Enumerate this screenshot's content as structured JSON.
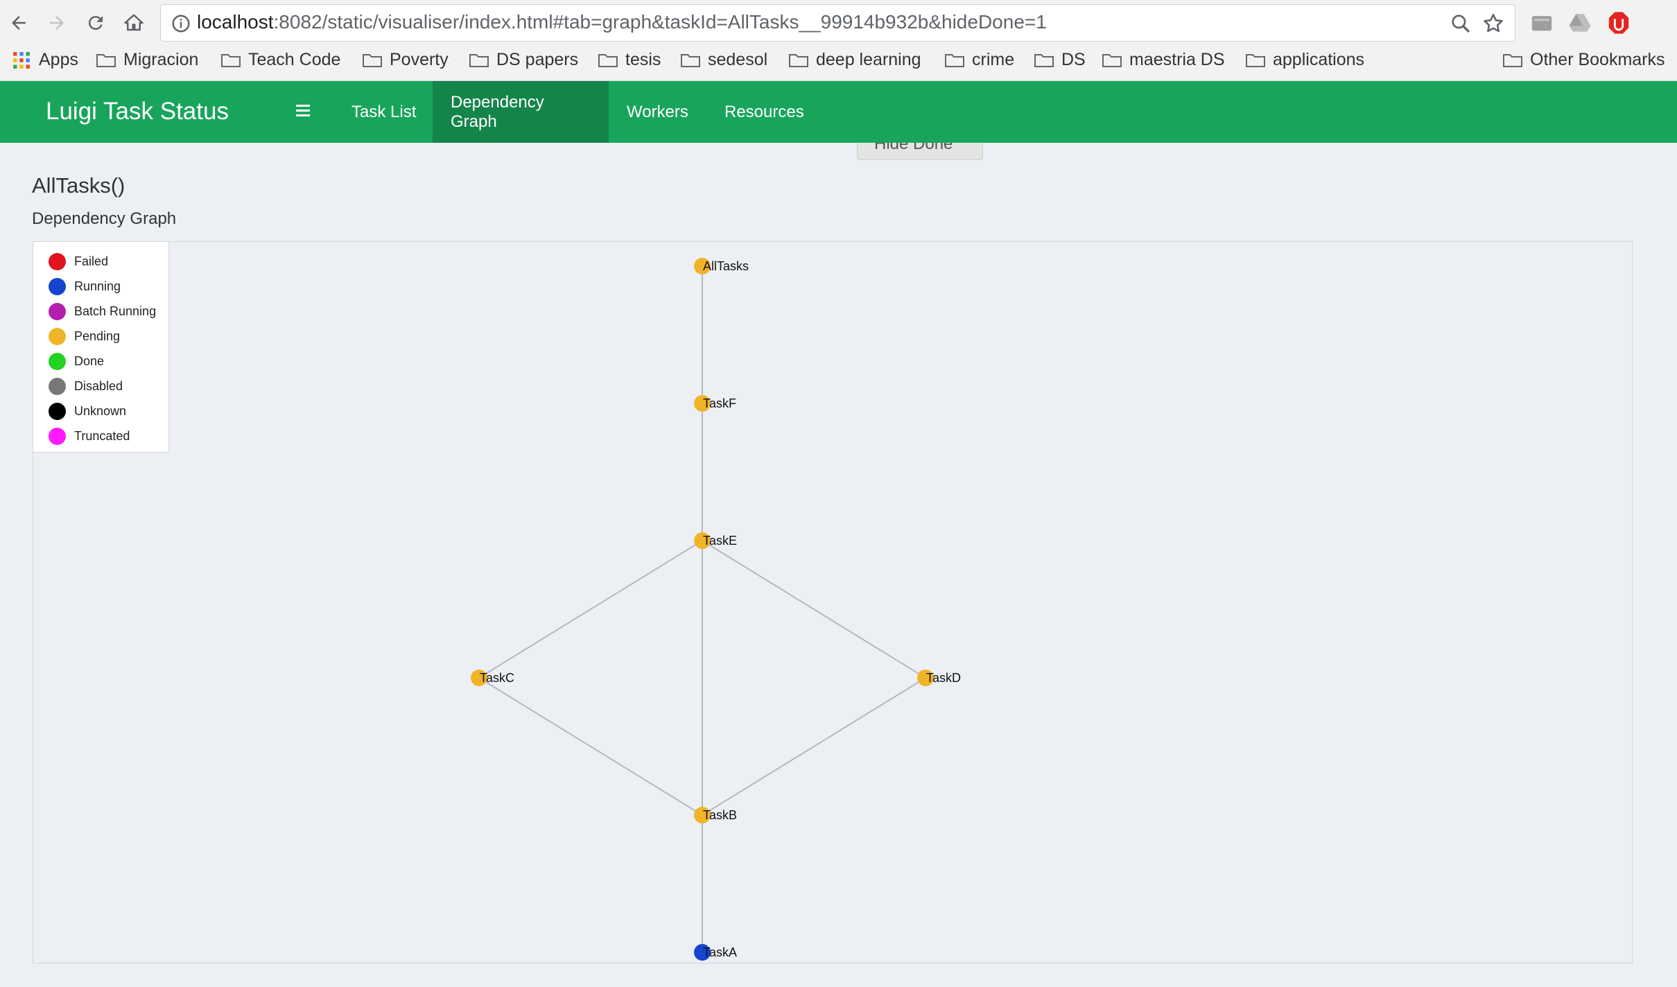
{
  "browser": {
    "url_host": "localhost",
    "url_rest": ":8082/static/visualiser/index.html#tab=graph&taskId=AllTasks__99914b932b&hideDone=1",
    "bookmarks": [
      {
        "label": "Apps",
        "icon": "apps-grid-icon"
      },
      {
        "label": "Migracion",
        "icon": "folder-icon"
      },
      {
        "label": "Teach Code",
        "icon": "folder-icon"
      },
      {
        "label": "Poverty",
        "icon": "folder-icon"
      },
      {
        "label": "DS papers",
        "icon": "folder-icon"
      },
      {
        "label": "tesis",
        "icon": "folder-icon"
      },
      {
        "label": "sedesol",
        "icon": "folder-icon"
      },
      {
        "label": "deep learning",
        "icon": "folder-icon"
      },
      {
        "label": "crime",
        "icon": "folder-icon"
      },
      {
        "label": "DS",
        "icon": "folder-icon"
      },
      {
        "label": "maestria DS",
        "icon": "folder-icon"
      },
      {
        "label": "applications",
        "icon": "folder-icon"
      }
    ],
    "other_bookmarks": "Other Bookmarks"
  },
  "navbar": {
    "brand": "Luigi Task Status",
    "items": [
      {
        "label": "Task List",
        "active": false
      },
      {
        "label": "Dependency Graph",
        "active": true
      },
      {
        "label": "Workers",
        "active": false
      },
      {
        "label": "Resources",
        "active": false
      }
    ],
    "color": "#18a55b",
    "active_color": "#14854a"
  },
  "main": {
    "hide_done_label": "Hide Done",
    "task_title": "AllTasks()",
    "section_title": "Dependency Graph"
  },
  "legend": [
    {
      "label": "Failed",
      "color": "#e0141e"
    },
    {
      "label": "Running",
      "color": "#1644cf"
    },
    {
      "label": "Batch Running",
      "color": "#b41fb0"
    },
    {
      "label": "Pending",
      "color": "#f0b428"
    },
    {
      "label": "Done",
      "color": "#22d322"
    },
    {
      "label": "Disabled",
      "color": "#777777"
    },
    {
      "label": "Unknown",
      "color": "#000000"
    },
    {
      "label": "Truncated",
      "color": "#ff1aff"
    }
  ],
  "graph": {
    "nodes": [
      {
        "id": "AllTasks",
        "status": "Pending"
      },
      {
        "id": "TaskF",
        "status": "Pending"
      },
      {
        "id": "TaskE",
        "status": "Pending"
      },
      {
        "id": "TaskC",
        "status": "Pending"
      },
      {
        "id": "TaskD",
        "status": "Pending"
      },
      {
        "id": "TaskB",
        "status": "Pending"
      },
      {
        "id": "TaskA",
        "status": "Running"
      }
    ],
    "edges": [
      [
        "AllTasks",
        "TaskF"
      ],
      [
        "TaskF",
        "TaskE"
      ],
      [
        "TaskE",
        "TaskC"
      ],
      [
        "TaskE",
        "TaskD"
      ],
      [
        "TaskE",
        "TaskB"
      ],
      [
        "TaskC",
        "TaskB"
      ],
      [
        "TaskD",
        "TaskB"
      ],
      [
        "TaskB",
        "TaskA"
      ]
    ]
  }
}
